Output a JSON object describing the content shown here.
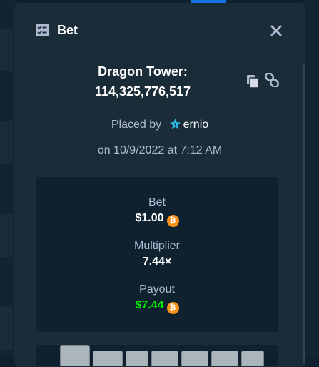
{
  "modal": {
    "title": "Bet",
    "game_title_line1": "Dragon Tower:",
    "game_title_line2": "114,325,776,517",
    "placed_by_prefix": "Placed by",
    "username": "ernio",
    "date": "on 10/9/2022 at 7:12 AM"
  },
  "stats": {
    "bet_label": "Bet",
    "bet_value": "$1.00",
    "multiplier_label": "Multiplier",
    "multiplier_value": "7.44×",
    "payout_label": "Payout",
    "payout_value": "$7.44",
    "currency_icon": "bitcoin-icon",
    "currency_symbol": "₿"
  },
  "colors": {
    "background": "#0f212e",
    "modal": "#1a2c38",
    "text_muted": "#b1bad3",
    "win_green": "#00e701",
    "bitcoin_orange": "#f7931a",
    "accent_blue": "#1475e1"
  }
}
